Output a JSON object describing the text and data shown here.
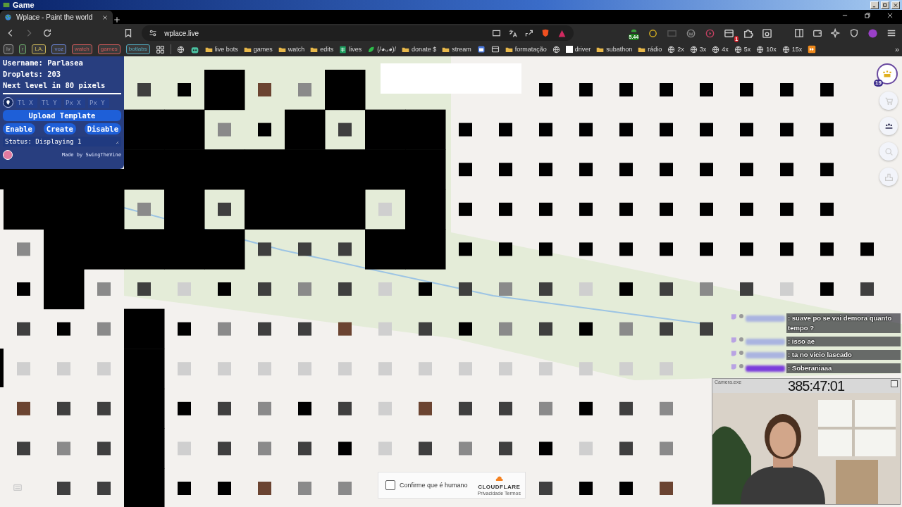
{
  "os_window": {
    "title": "Game"
  },
  "browser": {
    "tabs": [
      {
        "title": "Wplace - Paint the world",
        "selected": true
      }
    ],
    "url": "wplace.live",
    "extensions": [
      {
        "kind": "meter",
        "badge": "5.44"
      },
      {
        "kind": "coin"
      },
      {
        "kind": "screen"
      },
      {
        "kind": "letter"
      },
      {
        "kind": "play"
      },
      {
        "kind": "mail",
        "badge": "1"
      },
      {
        "kind": "puzzle"
      },
      {
        "kind": "capture"
      }
    ]
  },
  "bookmarks": [
    {
      "kind": "chip",
      "label": "lv",
      "color": "#9e9e9e"
    },
    {
      "kind": "chip",
      "label": "r",
      "color": "#6aa86a"
    },
    {
      "kind": "chip",
      "label": "LA.",
      "color": "#c9b458"
    },
    {
      "kind": "chip",
      "label": "voz",
      "color": "#6b86d8"
    },
    {
      "kind": "chip",
      "label": "watch",
      "color": "#d05a5a"
    },
    {
      "kind": "chip",
      "label": "games",
      "color": "#d05a5a"
    },
    {
      "kind": "chip",
      "label": "botlabs",
      "color": "#52a9bd"
    },
    {
      "kind": "apps"
    },
    {
      "kind": "globe"
    },
    {
      "kind": "robot"
    },
    {
      "kind": "folder",
      "label": "live bots"
    },
    {
      "kind": "folder",
      "label": "games"
    },
    {
      "kind": "folder",
      "label": "watch"
    },
    {
      "kind": "folder",
      "label": "edits"
    },
    {
      "kind": "sheet",
      "label": "lives"
    },
    {
      "kind": "leaf",
      "label": "(/◕ᴗ◕)/"
    },
    {
      "kind": "folder",
      "label": "donate $"
    },
    {
      "kind": "folder",
      "label": "stream"
    },
    {
      "kind": "calendar"
    },
    {
      "kind": "box"
    },
    {
      "kind": "folder",
      "label": "formatação"
    },
    {
      "kind": "globe"
    },
    {
      "kind": "page",
      "label": "driver"
    },
    {
      "kind": "folder",
      "label": "subathon"
    },
    {
      "kind": "folder",
      "label": "rádio"
    },
    {
      "kind": "globe",
      "label": "2x"
    },
    {
      "kind": "globe",
      "label": "3x"
    },
    {
      "kind": "globe",
      "label": "4x"
    },
    {
      "kind": "globe",
      "label": "5x"
    },
    {
      "kind": "globe",
      "label": "10x"
    },
    {
      "kind": "globe",
      "label": "15x"
    },
    {
      "kind": "forward"
    }
  ],
  "bookmarks_overflow": "»",
  "panel": {
    "lines": [
      "Username: Parlasea",
      "Droplets: 203",
      "Next level in 80 pixels"
    ],
    "fields": [
      {
        "placeholder": "Tl X"
      },
      {
        "placeholder": "Tl Y"
      },
      {
        "placeholder": "Px X"
      },
      {
        "placeholder": "Px Y"
      }
    ],
    "upload": "Upload Template",
    "buttons": [
      "Enable",
      "Create",
      "Disable"
    ],
    "status": "Status: Displaying 1",
    "credit": "Made by SwingTheVine"
  },
  "profile": {
    "badge": "19"
  },
  "chat": [
    {
      "text": ": suave po se vai demora quanto tempo ?",
      "color": "#aab4e0"
    },
    {
      "text": ": isso ae",
      "color": "#aab4e0"
    },
    {
      "text": ": ta no vicio lascado",
      "color": "#aab4e0"
    },
    {
      "text": ": Soberaniaaa",
      "color": "#7a3ddb"
    }
  ],
  "camera": {
    "title": "Camera.exe",
    "timer": "385:47:01"
  },
  "captcha": {
    "label": "Confirme que é humano",
    "checked": false,
    "brand": "CLOUDFLARE",
    "links": [
      "Privacidade",
      "Termos"
    ]
  }
}
